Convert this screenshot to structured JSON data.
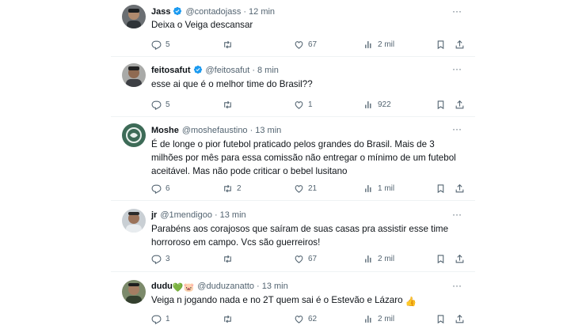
{
  "tweets": [
    {
      "name": "Jass",
      "verified": true,
      "handle": "@contadojass",
      "dot": "·",
      "time": "12 min",
      "text": "Deixa o Veiga descansar",
      "replies": "5",
      "retweets": "",
      "likes": "67",
      "views": "2 mil",
      "more": "···"
    },
    {
      "name": "feitosafut",
      "verified": true,
      "handle": "@feitosafut",
      "dot": "·",
      "time": "8 min",
      "text": "esse ai que é o melhor time do Brasil??",
      "replies": "5",
      "retweets": "",
      "likes": "1",
      "views": "922",
      "more": "···"
    },
    {
      "name": "Moshe",
      "verified": false,
      "handle": "@moshefaustino",
      "dot": "·",
      "time": "13 min",
      "text": "É de longe o pior futebol praticado pelos grandes do Brasil. Mais de 3 milhões por mês para essa comissão não entregar o mínimo de um futebol aceitável. Mas não pode criticar o bebel lusitano",
      "replies": "6",
      "retweets": "2",
      "likes": "21",
      "views": "1 mil",
      "more": "···"
    },
    {
      "name": "jr",
      "verified": false,
      "handle": "@1mendigoo",
      "dot": "·",
      "time": "13 min",
      "text": "Parabéns aos corajosos que saíram de suas casas pra assistir esse time horroroso em campo. Vcs são guerreiros!",
      "replies": "3",
      "retweets": "",
      "likes": "67",
      "views": "2 mil",
      "more": "···"
    },
    {
      "name": "dudu",
      "name_emoji": "💚🐷",
      "verified": false,
      "handle": "@duduzanatto",
      "dot": "·",
      "time": "13 min",
      "text": "Veiga n jogando nada e no 2T quem sai é o Estevão e Lázaro",
      "text_emoji": "👍",
      "replies": "1",
      "retweets": "",
      "likes": "62",
      "views": "2 mil",
      "more": "···"
    }
  ],
  "colors": {
    "text": "#0f1419",
    "secondary": "#536471",
    "verified": "#1d9bf0",
    "divider": "#eff3f4"
  },
  "icons": [
    "reply-icon",
    "retweet-icon",
    "like-icon",
    "views-icon",
    "bookmark-icon",
    "share-icon",
    "verified-badge-icon",
    "more-icon"
  ]
}
